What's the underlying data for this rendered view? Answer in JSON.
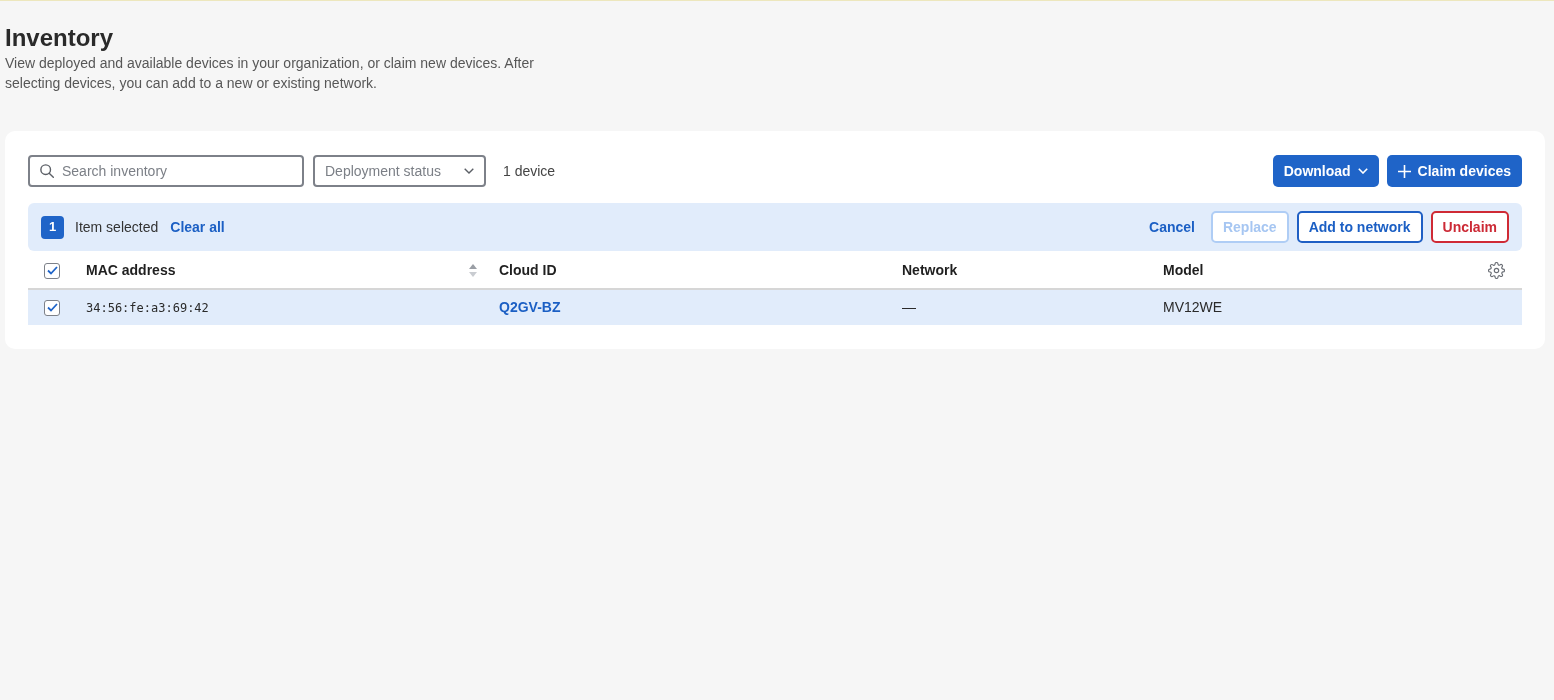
{
  "page": {
    "title": "Inventory",
    "description": "View deployed and available devices in your organization, or claim new devices. After selecting devices, you can add to a new or existing network."
  },
  "toolbar": {
    "search": {
      "placeholder": "Search inventory"
    },
    "filter": {
      "placeholder": "Deployment status"
    },
    "count": "1 device",
    "buttons": [
      {
        "label": "Download",
        "kind": "dropdown"
      },
      {
        "label": "Claim devices",
        "kind": "add"
      }
    ]
  },
  "selection_bar": {
    "count": "1",
    "label": "Item selected",
    "clear": "Clear all",
    "actions": [
      {
        "label": "Cancel",
        "kind": "link",
        "disabled": false
      },
      {
        "label": "Replace",
        "kind": "outline",
        "disabled": true
      },
      {
        "label": "Add to network",
        "kind": "outline",
        "disabled": false
      },
      {
        "label": "Unclaim",
        "kind": "danger",
        "disabled": false
      }
    ]
  },
  "table": {
    "all_checked": true,
    "columns": [
      {
        "label": "MAC address",
        "kind": "mono",
        "sortable": true
      },
      {
        "label": "Cloud ID",
        "kind": "link",
        "sortable": false
      },
      {
        "label": "Network",
        "kind": "text",
        "sortable": false
      },
      {
        "label": "Model",
        "kind": "text",
        "sortable": false
      }
    ],
    "rows": [
      {
        "checked": true,
        "selected": true,
        "cells": [
          "34:56:fe:a3:69:42",
          "Q2GV-BZ",
          "—",
          "MV12WE"
        ]
      }
    ]
  }
}
